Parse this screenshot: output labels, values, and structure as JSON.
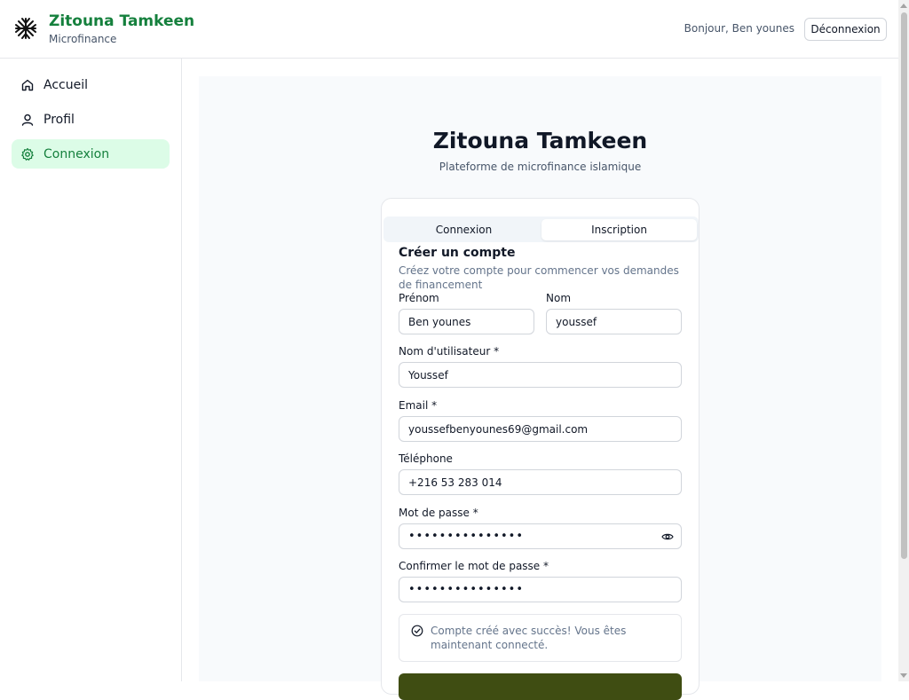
{
  "header": {
    "brand_title": "Zitouna Tamkeen",
    "brand_subtitle": "Microfinance",
    "greeting": "Bonjour, Ben younes",
    "logout_label": "Déconnexion",
    "logo_icon": "tree-logo-icon"
  },
  "sidebar": {
    "items": [
      {
        "label": "Accueil",
        "icon": "home-icon",
        "active": false
      },
      {
        "label": "Profil",
        "icon": "user-icon",
        "active": false
      },
      {
        "label": "Connexion",
        "icon": "gear-icon",
        "active": true
      }
    ]
  },
  "main": {
    "title": "Zitouna Tamkeen",
    "subtitle": "Plateforme de microfinance islamique"
  },
  "auth": {
    "tabs": {
      "login": "Connexion",
      "register": "Inscription",
      "selected": "Inscription"
    },
    "card_title": "Créer un compte",
    "card_description": "Créez votre compte pour commencer vos demandes de financement",
    "fields": {
      "first_name": {
        "label": "Prénom",
        "value": "Ben younes"
      },
      "last_name": {
        "label": "Nom",
        "value": "youssef"
      },
      "username": {
        "label": "Nom d'utilisateur *",
        "value": "Youssef"
      },
      "email": {
        "label": "Email *",
        "value": "youssefbenyounes69@gmail.com"
      },
      "phone": {
        "label": "Téléphone",
        "value": "+216 53 283 014"
      },
      "password": {
        "label": "Mot de passe *",
        "value": "•••••••••••••••"
      },
      "confirm_password": {
        "label": "Confirmer le mot de passe *",
        "value": "•••••••••••••••"
      }
    },
    "success_message": "Compte créé avec succès! Vous êtes maintenant connecté."
  },
  "colors": {
    "brand": "#15803d",
    "active_nav_bg": "#dcfce7",
    "submit_button": "#3f4d12"
  }
}
